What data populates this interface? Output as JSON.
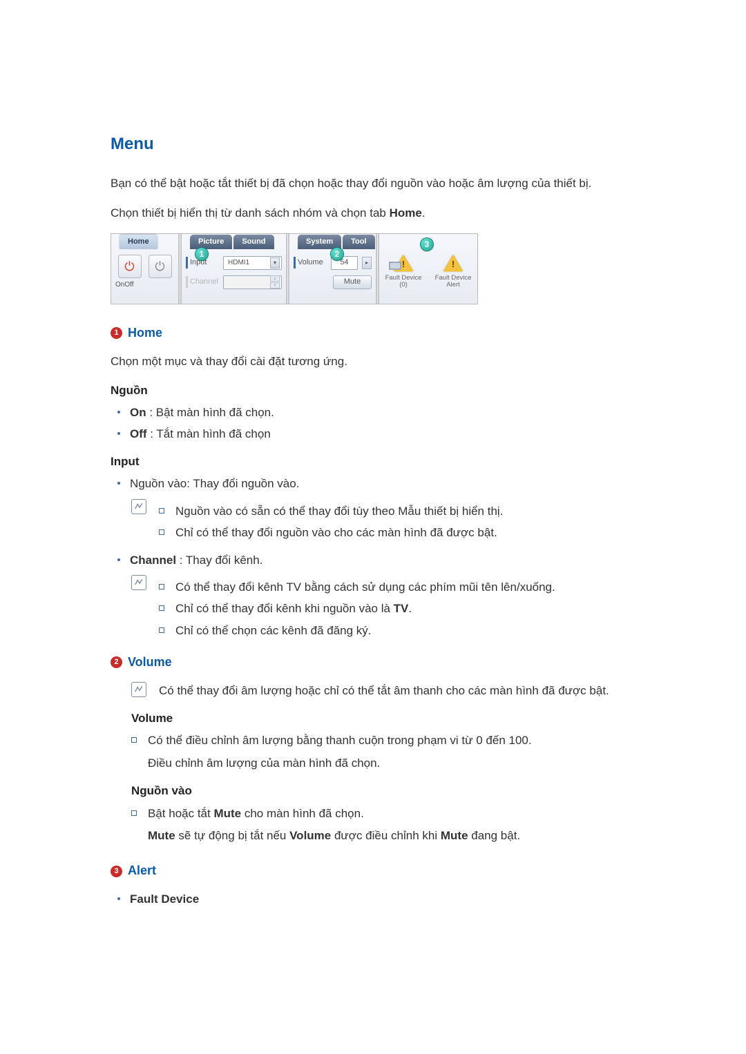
{
  "h1": "Menu",
  "intro1": "Bạn có thể bật hoặc tắt thiết bị đã chọn hoặc thay đổi nguồn vào hoặc âm lượng của thiết bị.",
  "intro2_a": "Chọn thiết bị hiển thị từ danh sách nhóm và chọn tab ",
  "intro2_b": "Home",
  "intro2_c": ".",
  "fig": {
    "tabs": [
      "Home",
      "Picture",
      "Sound",
      "System",
      "Tool"
    ],
    "pins": [
      "1",
      "2",
      "3"
    ],
    "on": "On",
    "off": "Off",
    "input_lbl": "Input",
    "input_val": "HDMI1",
    "channel_lbl": "Channel",
    "volume_lbl": "Volume",
    "volume_val": "54",
    "mute": "Mute",
    "fault_device_0": "Fault Device (0)",
    "fault_device_alert": "Fault Device Alert"
  },
  "sec1": {
    "num": "1",
    "title": "Home",
    "desc": "Chọn một mục và thay đổi cài đặt tương ứng.",
    "source_h": "Nguồn",
    "on_k": "On",
    "on_v": " : Bật màn hình đã chọn.",
    "off_k": "Off",
    "off_v": " : Tắt màn hình đã chọn",
    "input_h": "Input",
    "input_line": "Nguồn vào: Thay đổi nguồn vào.",
    "input_note1": "Nguồn vào có sẵn có thể thay đổi tùy theo Mẫu thiết bị hiển thị.",
    "input_note2": "Chỉ có thể thay đổi nguồn vào cho các màn hình đã được bật.",
    "channel_k": "Channel",
    "channel_v": " : Thay đổi kênh.",
    "ch_note1": "Có thể thay đổi kênh TV bằng cách sử dụng các phím mũi tên lên/xuống.",
    "ch_note2_a": "Chỉ có thể thay đổi kênh khi nguồn vào là ",
    "ch_note2_b": "TV",
    "ch_note2_c": ".",
    "ch_note3": "Chỉ có thể chọn các kênh đã đăng ký."
  },
  "sec2": {
    "num": "2",
    "title": "Volume",
    "top_note": "Có thể thay đổi âm lượng hoặc chỉ có thể tắt âm thanh cho các màn hình đã được bật.",
    "vol_h": "Volume",
    "vol_l1": "Có thể điều chỉnh âm lượng bằng thanh cuộn trong phạm vi từ 0 đến 100.",
    "vol_l2": "Điều chỉnh âm lượng của màn hình đã chọn.",
    "src_h": "Nguồn vào",
    "src_l1_a": "Bật hoặc tắt ",
    "src_l1_b": "Mute",
    "src_l1_c": " cho màn hình đã chọn.",
    "src_l2_a": "Mute",
    "src_l2_b": " sẽ tự động bị tắt nếu ",
    "src_l2_c": "Volume",
    "src_l2_d": " được điều chỉnh khi ",
    "src_l2_e": "Mute",
    "src_l2_f": " đang bật."
  },
  "sec3": {
    "num": "3",
    "title": "Alert",
    "fd": "Fault Device"
  }
}
